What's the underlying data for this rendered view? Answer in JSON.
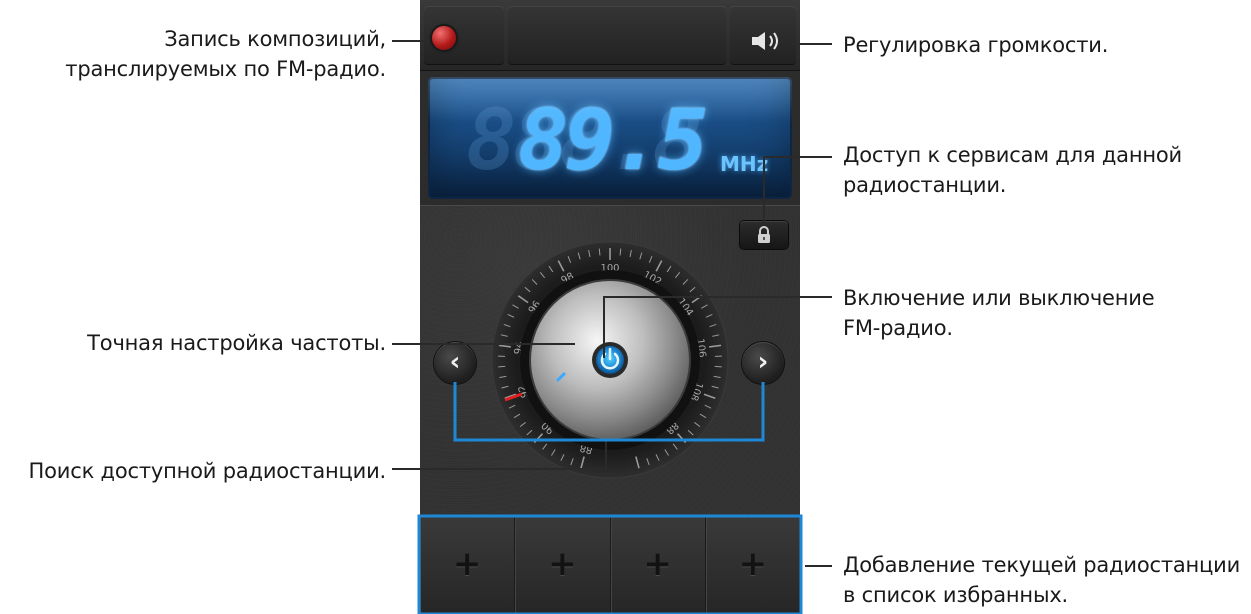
{
  "callouts": {
    "record": [
      "Запись композиций,",
      "транслируемых по FM-радио."
    ],
    "volume": [
      "Регулировка громкости."
    ],
    "services": [
      "Доступ к сервисам для данной",
      "радиостанции."
    ],
    "power": [
      "Включение или выключение",
      "FM-радио."
    ],
    "fine_tune": [
      "Точная настройка частоты."
    ],
    "search": [
      "Поиск доступной радиостанции."
    ],
    "favorites": [
      "Добавление текущей радиостанции",
      "в список избранных."
    ]
  },
  "radio": {
    "ghost_digits": "888.8",
    "frequency": "89.5",
    "unit": "MHz",
    "prev_glyph": "‹",
    "next_glyph": "›",
    "dial_ticks": [
      "88",
      "90",
      "92",
      "94",
      "96",
      "98",
      "100",
      "102",
      "104",
      "106",
      "108",
      "88"
    ],
    "favorites": [
      "+",
      "+",
      "+",
      "+"
    ]
  },
  "icons": {
    "record": "record-icon",
    "volume": "speaker-icon",
    "services": "lock-icon",
    "power": "power-icon"
  },
  "colors": {
    "lcd_digits": "#4fb6ff",
    "callout_line": "#1e88d8",
    "record": "#b31a1a",
    "needle": "#e02020"
  }
}
